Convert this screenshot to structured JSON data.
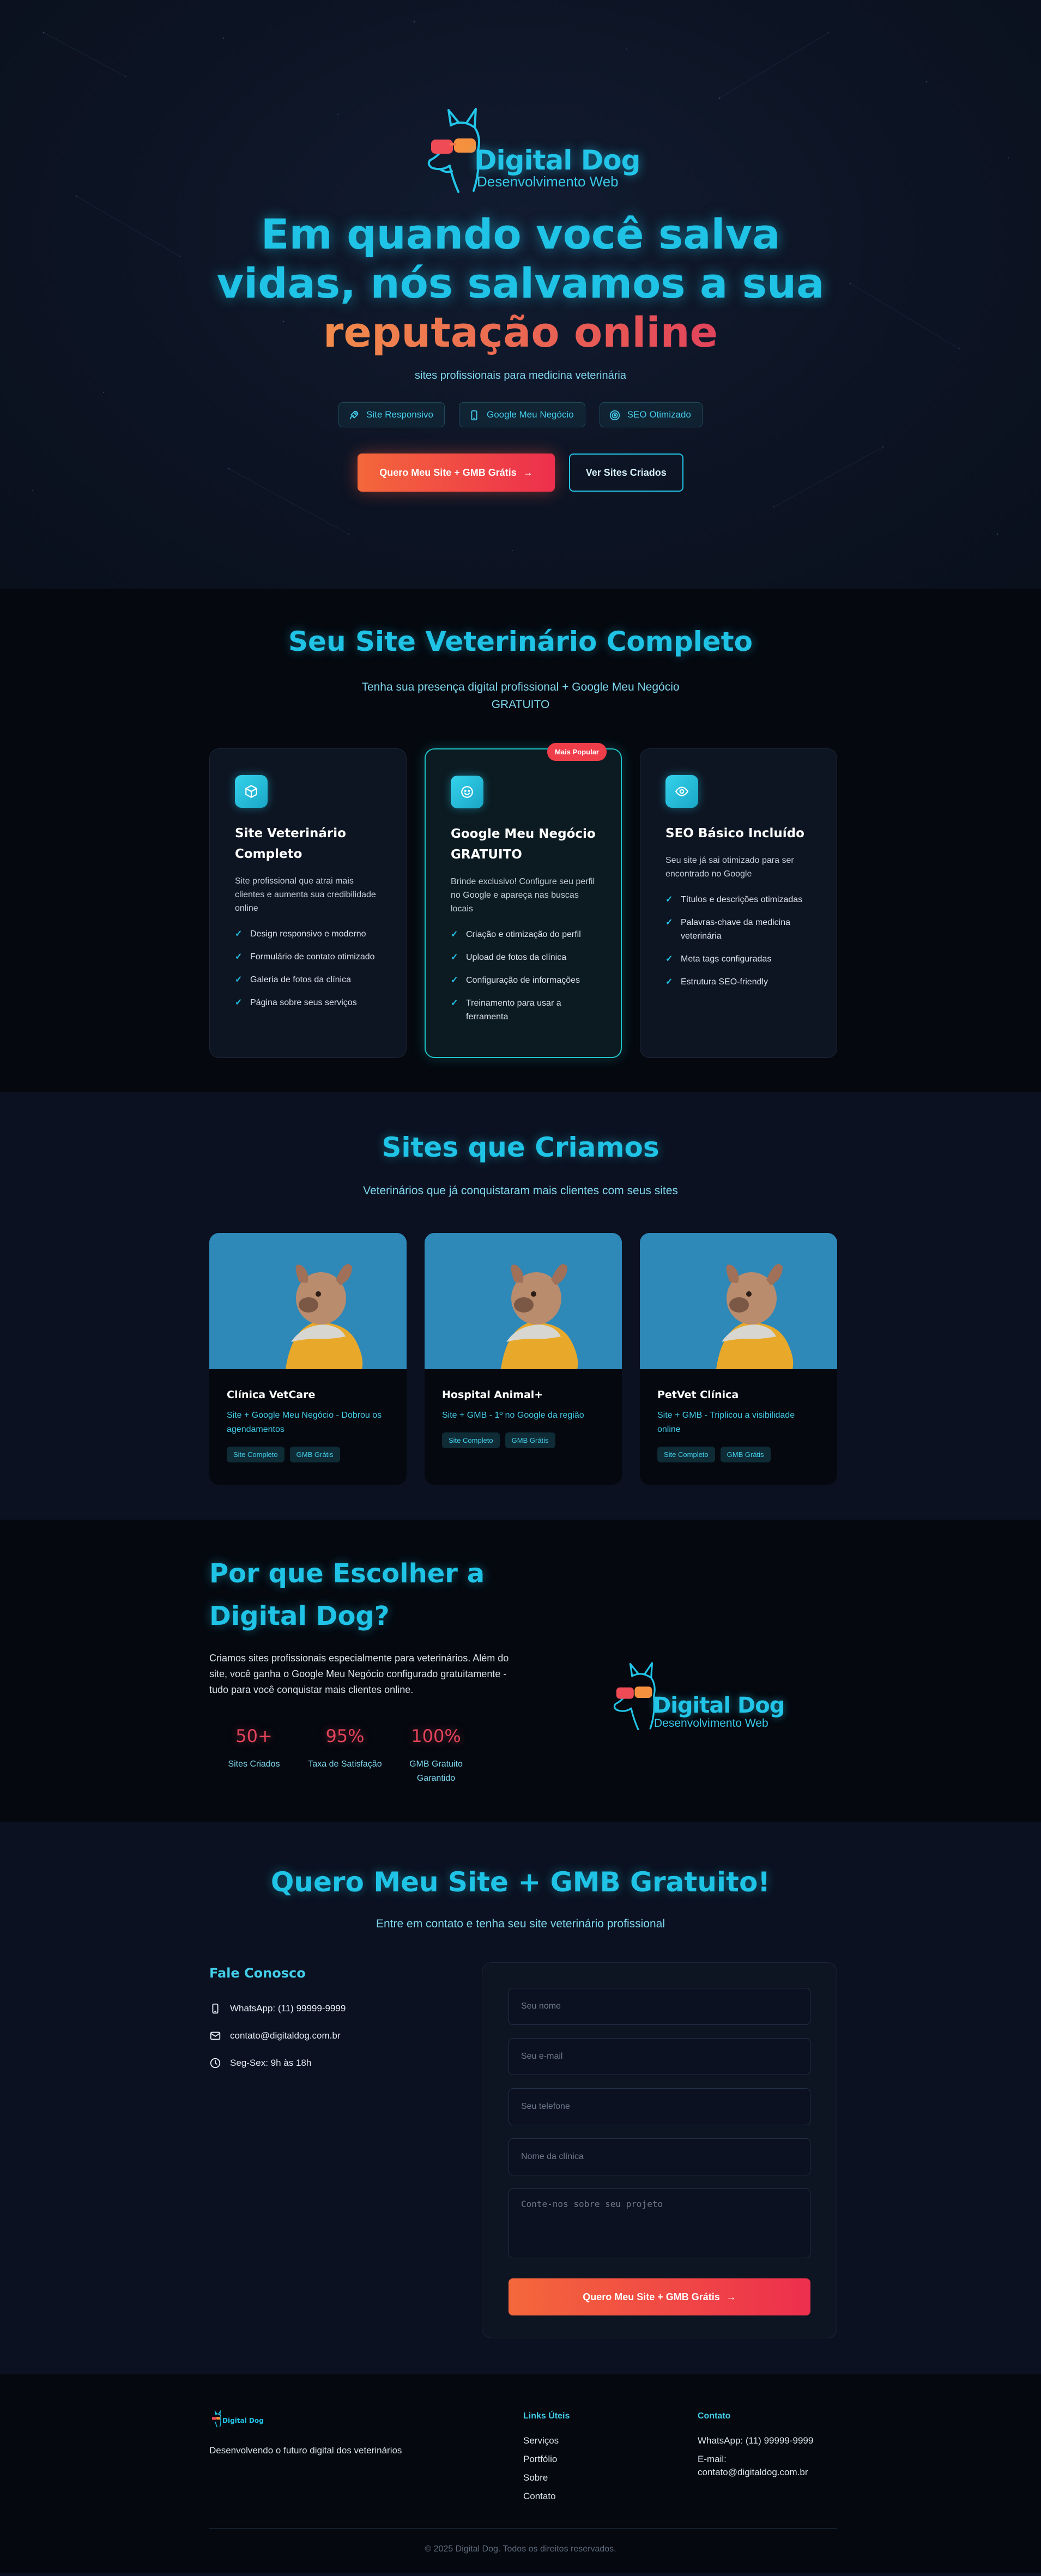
{
  "brand": {
    "name": "Digital Dog",
    "tagline": "Desenvolvimento Web"
  },
  "colors": {
    "accent": "#1fc3e6",
    "cta_start": "#f4673b",
    "cta_end": "#ed2f4d",
    "background": "#0b1120"
  },
  "hero": {
    "title_line1": "Em quando você salva",
    "title_line2": "vidas, nós salvamos a sua",
    "title_line3": "reputação online",
    "subtitle": "sites profissionais para medicina veterinária",
    "pills": [
      {
        "label": "Site Responsivo",
        "icon": "rocket-icon"
      },
      {
        "label": "Google Meu Negócio",
        "icon": "phone-icon"
      },
      {
        "label": "SEO Otimizado",
        "icon": "target-icon"
      }
    ],
    "primary_cta": "Quero Meu Site + GMB Grátis",
    "secondary_cta": "Ver Sites Criados"
  },
  "services": {
    "title": "Seu Site Veterinário Completo",
    "subtitle_line1": "Tenha sua presença digital profissional + Google Meu Negócio",
    "subtitle_line2": "GRATUITO",
    "cards": [
      {
        "icon": "cube-icon",
        "title_line1": "Site Veterinário",
        "title_line2": "Completo",
        "desc": "Site profissional que atrai mais clientes e aumenta sua credibilidade online",
        "items": [
          "Design responsivo e moderno",
          "Formulário de contato otimizado",
          "Galeria de fotos da clínica",
          "Página sobre seus serviços"
        ]
      },
      {
        "icon": "smile-icon",
        "badge": "Mais Popular",
        "title_line1": "Google Meu Negócio",
        "title_line2": "GRATUITO",
        "desc": "Brinde exclusivo! Configure seu perfil no Google e apareça nas buscas locais",
        "items": [
          "Criação e otimização do perfil",
          "Upload de fotos da clínica",
          "Configuração de informações",
          "Treinamento para usar a ferramenta"
        ]
      },
      {
        "icon": "eye-icon",
        "title_line1": "SEO Básico Incluído",
        "title_line2": "",
        "desc": "Seu site já sai otimizado para ser encontrado no Google",
        "items": [
          "Títulos e descrições otimizadas",
          "Palavras-chave da medicina veterinária",
          "Meta tags configuradas",
          "Estrutura SEO-friendly"
        ]
      }
    ]
  },
  "portfolio": {
    "title": "Sites que Criamos",
    "subtitle": "Veterinários que já conquistaram mais clientes com seus sites",
    "items": [
      {
        "name": "Clínica VetCare",
        "desc": "Site + Google Meu Negócio - Dobrou os agendamentos",
        "tags": [
          "Site Completo",
          "GMB Grátis"
        ]
      },
      {
        "name": "Hospital Animal+",
        "desc": "Site + GMB - 1º no Google da região",
        "tags": [
          "Site Completo",
          "GMB Grátis"
        ]
      },
      {
        "name": "PetVet Clínica",
        "desc": "Site + GMB - Triplicou a visibilidade online",
        "tags": [
          "Site Completo",
          "GMB Grátis"
        ]
      }
    ]
  },
  "why": {
    "title_line1": "Por que Escolher a",
    "title_line2": "Digital Dog?",
    "text": "Criamos sites profissionais especialmente para veterinários. Além do site, você ganha o Google Meu Negócio configurado gratuitamente - tudo para você conquistar mais clientes online.",
    "stats": [
      {
        "value": "50+",
        "label_line1": "Sites Criados",
        "label_line2": ""
      },
      {
        "value": "95%",
        "label_line1": "Taxa de Satisfação",
        "label_line2": ""
      },
      {
        "value": "100%",
        "label_line1": "GMB Gratuito",
        "label_line2": "Garantido"
      }
    ]
  },
  "contact": {
    "title": "Quero Meu Site + GMB Gratuito!",
    "subtitle": "Entre em contato e tenha seu site veterinário profissional",
    "info_title": "Fale Conosco",
    "whatsapp": "WhatsApp: (11) 99999-9999",
    "email": "contato@digitaldog.com.br",
    "hours": "Seg-Sex: 9h às 18h",
    "form": {
      "name_placeholder": "Seu nome",
      "email_placeholder": "Seu e-mail",
      "phone_placeholder": "Seu telefone",
      "clinic_placeholder": "Nome da clínica",
      "message_placeholder": "Conte-nos sobre seu projeto",
      "submit": "Quero Meu Site + GMB Grátis"
    }
  },
  "footer": {
    "logo_text": "Digital Dog",
    "tagline": "Desenvolvendo o futuro digital dos veterinários",
    "links_title": "Links Úteis",
    "links": [
      "Serviços",
      "Portfólio",
      "Sobre",
      "Contato"
    ],
    "contact_title": "Contato",
    "contact_whatsapp": "WhatsApp: (11) 99999-9999",
    "contact_email_label": "E-mail:",
    "contact_email": "contato@digitaldog.com.br",
    "copyright": "© 2025 Digital Dog. Todos os direitos reservados."
  }
}
